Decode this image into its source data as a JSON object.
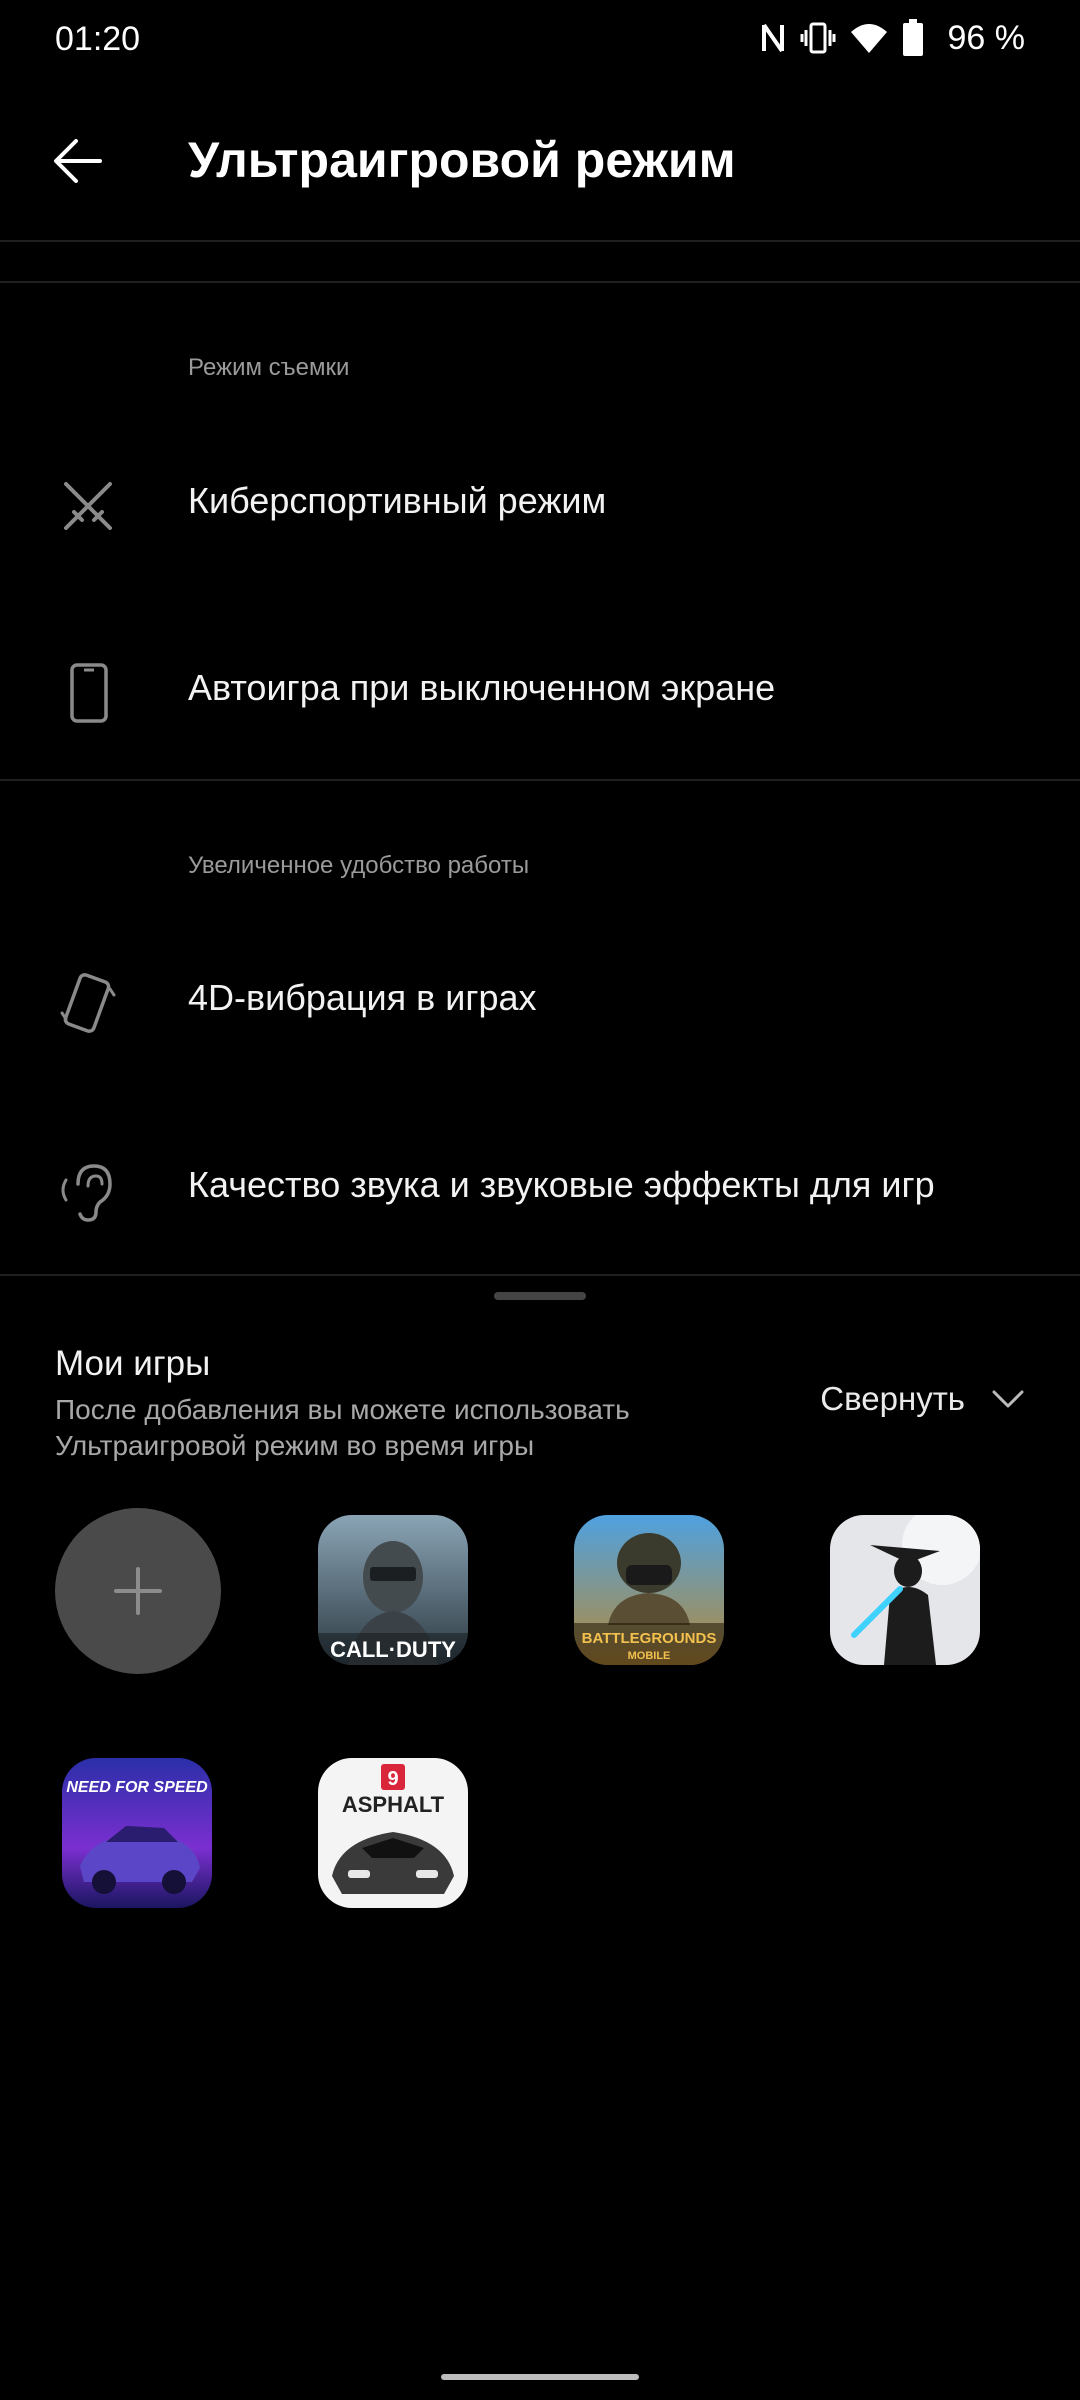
{
  "status_bar": {
    "time": "01:20",
    "battery": "96 %",
    "icons": [
      "nfc-icon",
      "vibrate-icon",
      "wifi-icon",
      "battery-icon"
    ]
  },
  "app_bar": {
    "title": "Ультраигровой режим",
    "back_icon": "arrow-left-icon"
  },
  "sections": [
    {
      "header": "Режим съемки",
      "items": [
        {
          "label": "Киберспортивный режим",
          "icon": "crossed-swords-icon"
        },
        {
          "label": "Автоигра при выключенном экране",
          "icon": "phone-outline-icon"
        }
      ]
    },
    {
      "header": "Увеличенное удобство работы",
      "items": [
        {
          "label": "4D-вибрация в играх",
          "icon": "tilted-phone-icon"
        },
        {
          "label": "Качество звука и звуковые эффекты для игр",
          "icon": "ear-icon"
        }
      ]
    }
  ],
  "my_games": {
    "title": "Мои игры",
    "description": "После добавления вы можете использовать Ультраигровой режим во время игры",
    "collapse_label": "Свернуть",
    "add_icon": "plus-icon",
    "games": [
      {
        "label": "CALL·DUTY",
        "icon": "call-of-duty-app-icon"
      },
      {
        "label": "BATTLEGROUNDS",
        "sub": "MOBILE",
        "icon": "pubg-app-icon"
      },
      {
        "label": "",
        "icon": "shadow-fight-app-icon"
      },
      {
        "label": "NEED FOR SPEED",
        "icon": "need-for-speed-app-icon"
      },
      {
        "label": "ASPHALT",
        "badge": "9",
        "icon": "asphalt-app-icon"
      }
    ]
  },
  "colors": {
    "background": "#000000",
    "divider": "#1f1f1f",
    "secondary_text": "#9a9a9a",
    "add_button": "#4a4a4a"
  }
}
